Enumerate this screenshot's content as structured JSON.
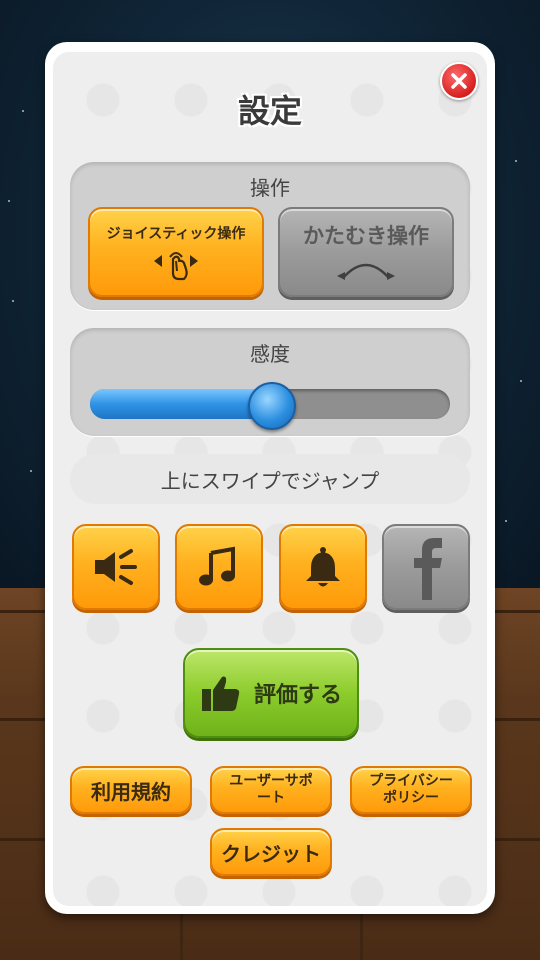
{
  "dialog": {
    "title": "設定",
    "close_icon": "close-x-icon"
  },
  "controls": {
    "label": "操作",
    "joystick_label": "ジョイスティック操作",
    "joystick_icon": "touch-drag-icon",
    "tilt_label": "かたむき操作",
    "tilt_icon": "tilt-arrow-icon",
    "selected": "joystick"
  },
  "sensitivity": {
    "label": "感度",
    "value": 0.5
  },
  "hint": {
    "text": "上にスワイプでジャンプ"
  },
  "toggles": [
    {
      "name": "sound",
      "icon": "speaker-icon",
      "enabled": true
    },
    {
      "name": "music",
      "icon": "music-note-icon",
      "enabled": true
    },
    {
      "name": "notification",
      "icon": "bell-icon",
      "enabled": true
    },
    {
      "name": "facebook",
      "icon": "facebook-icon",
      "enabled": false
    }
  ],
  "rate": {
    "label": "評価する",
    "icon": "thumbs-up-icon"
  },
  "links": {
    "terms": "利用規約",
    "support_line1": "ユーザーサポ",
    "support_line2": "ート",
    "privacy_line1": "プライバシー",
    "privacy_line2": "ポリシー",
    "credits": "クレジット"
  },
  "colors": {
    "orange": "#ffb11f",
    "gray": "#9b9b9b",
    "green": "#8ccc2c",
    "slider_blue": "#2f93e6",
    "close_red": "#d61f1f"
  }
}
